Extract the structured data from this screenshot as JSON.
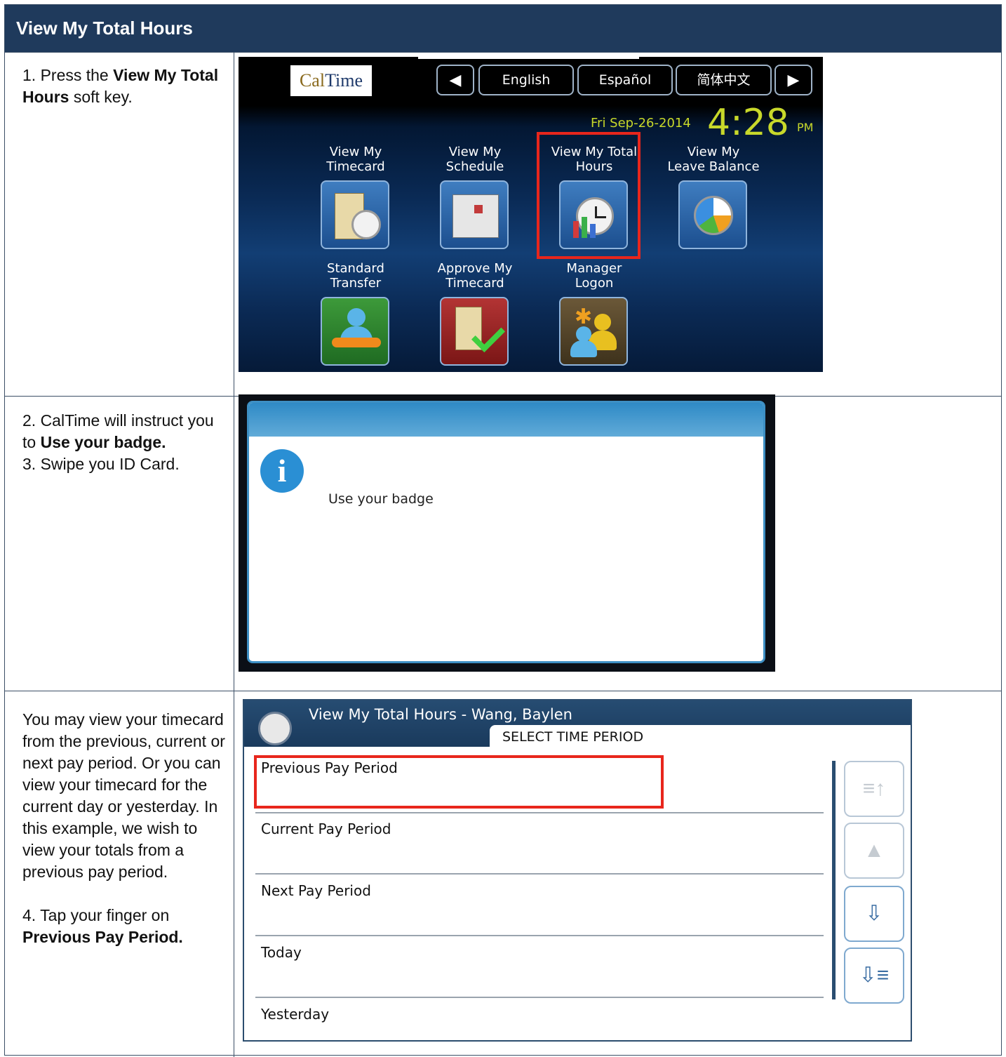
{
  "header": {
    "title": "View My Total Hours"
  },
  "steps": {
    "s1": {
      "a": "1. Press the ",
      "b": "View My Total Hours",
      "c": " soft key."
    },
    "s2": {
      "a": "2. CalTime will instruct you to ",
      "b": "Use your badge.",
      "c": "3. Swipe you ID Card."
    },
    "s3": {
      "para": "You may view your timecard from the previous, current or next pay period.  Or you can view your timecard for the current day or yesterday. In this example, we wish to view your totals from a previous pay period.",
      "a": "4. Tap your finger on ",
      "b": "Previous Pay Period."
    }
  },
  "screen1": {
    "logo_cal": "Cal",
    "logo_time": "Time",
    "languages": [
      "English",
      "Español",
      "简体中文"
    ],
    "date": "Fri Sep-26-2014",
    "time": "4:28",
    "ampm": "PM",
    "tiles": [
      {
        "line1": "View My",
        "line2": "Timecard",
        "icon": "timecard-clock-icon"
      },
      {
        "line1": "View My",
        "line2": "Schedule",
        "icon": "schedule-calendar-icon"
      },
      {
        "line1": "View My Total",
        "line2": "Hours",
        "icon": "total-hours-clock-chart-icon"
      },
      {
        "line1": "View My",
        "line2": "Leave Balance",
        "icon": "leave-balance-clock-icon"
      },
      {
        "line1": "Standard",
        "line2": "Transfer",
        "icon": "transfer-person-arrow-icon"
      },
      {
        "line1": "Approve My",
        "line2": "Timecard",
        "icon": "approve-timecard-check-icon"
      },
      {
        "line1": "Manager",
        "line2": "Logon",
        "icon": "manager-people-icon"
      }
    ],
    "highlight_color": "#e8261c"
  },
  "screen2": {
    "message": "Use your badge",
    "icon": "info-icon"
  },
  "screen3": {
    "title": "View My Total Hours - Wang, Baylen",
    "subtitle": "SELECT TIME PERIOD",
    "items": [
      "Previous Pay Period",
      "Current Pay Period",
      "Next Pay Period",
      "Today",
      "Yesterday"
    ],
    "nav": [
      "page-up-icon",
      "up-arrow-icon",
      "down-arrow-icon",
      "page-down-icon"
    ]
  }
}
